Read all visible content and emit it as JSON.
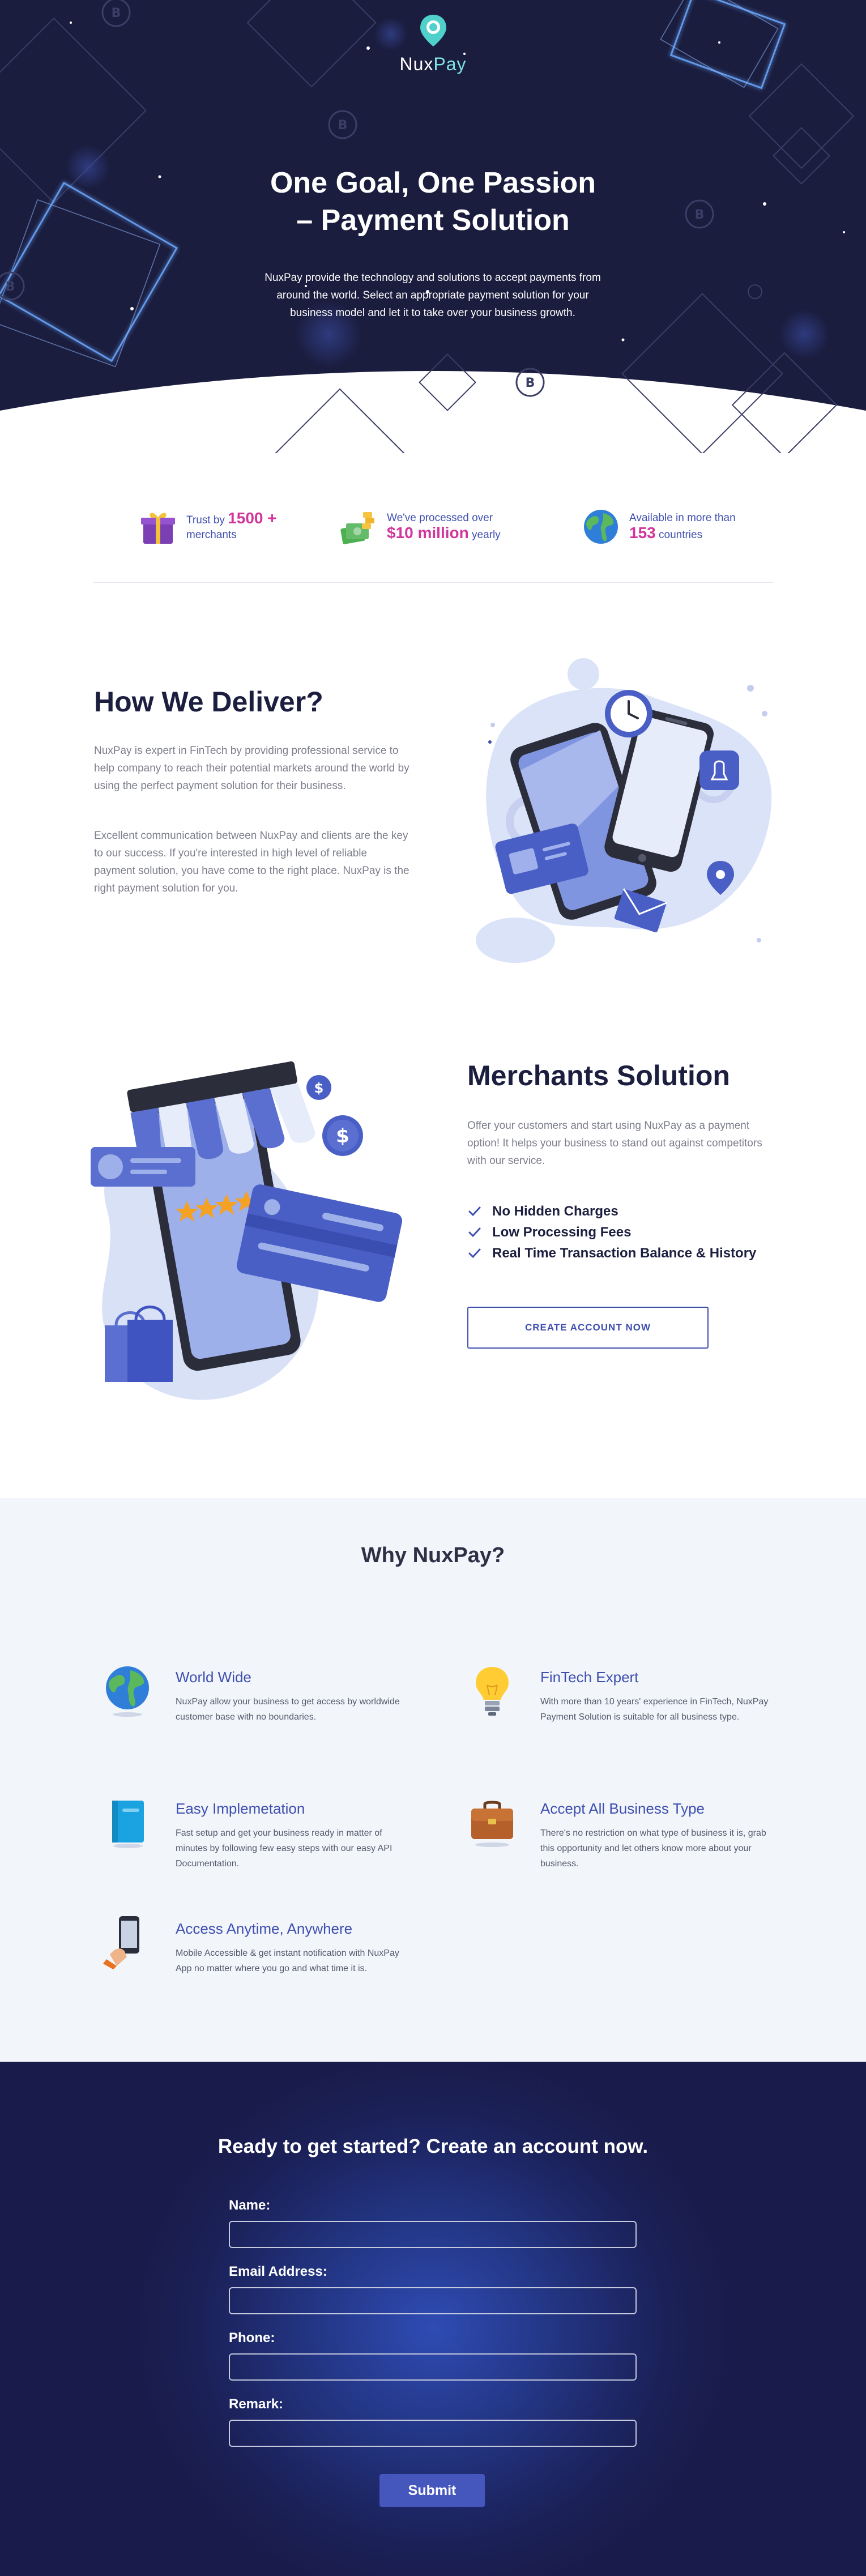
{
  "colors": {
    "hero_bg": "#1b1d3e",
    "brand_blue": "#3f4fb0",
    "accent_pink": "#d2359b",
    "accent_teal": "#7fe3df",
    "heading_dark": "#1c1e3f",
    "why_bg": "#f2f6fb",
    "submit_bg": "#4557bd"
  },
  "brand": {
    "name_prefix": "Nux",
    "name_suffix": "Pay",
    "icon": "location-pin-icon"
  },
  "hero": {
    "title_line1": "One Goal, One Passion",
    "title_line2": "– Payment Solution",
    "description": "NuxPay provide the technology and solutions to accept payments from around the world. Select an appropriate payment solution for your business model and let it to take over your business growth."
  },
  "stats": [
    {
      "icon": "gift-icon",
      "pre": "Trust by",
      "big": "1500 +",
      "post": "merchants"
    },
    {
      "icon": "money-stack-icon",
      "pre": "We've processed over",
      "big": "$10 million",
      "post": "yearly"
    },
    {
      "icon": "globe-icon",
      "pre": "Available in more than",
      "big": "153",
      "post": "countries"
    }
  ],
  "how": {
    "title": "How We Deliver?",
    "p1": "NuxPay is expert in FinTech by providing professional service to help company to reach their potential markets around the world by using the perfect payment solution for their business.",
    "p2": "Excellent communication between NuxPay and clients are the key to our success. If you're interested in high level of reliable payment solution, you have come to the right place. NuxPay is the right payment solution for you."
  },
  "merchants": {
    "title": "Merchants Solution",
    "description": "Offer your customers and start using NuxPay as a payment option! It helps your business to stand out against competitors with our service.",
    "features": [
      "No Hidden Charges",
      "Low Processing Fees",
      "Real Time Transaction Balance & History"
    ],
    "cta": "CREATE ACCOUNT NOW"
  },
  "why": {
    "title": "Why NuxPay?",
    "items": [
      {
        "icon": "globe-icon",
        "title": "World Wide",
        "desc": "NuxPay allow your business to get access by worldwide customer base with no boundaries."
      },
      {
        "icon": "lightbulb-icon",
        "title": "FinTech Expert",
        "desc": "With more than 10 years' experience in FinTech, NuxPay Payment Solution is suitable for all business type."
      },
      {
        "icon": "notebook-icon",
        "title": "Easy Implemetation",
        "desc": "Fast setup and get your business ready in matter of minutes by following few easy steps with our easy API Documentation."
      },
      {
        "icon": "briefcase-icon",
        "title": "Accept All Business Type",
        "desc": "There's no restriction on what type of business it is, grab this opportunity and let others know more about your business."
      },
      {
        "icon": "mobile-phone-icon",
        "title": "Access Anytime, Anywhere",
        "desc": "Mobile Accessible & get instant notification with NuxPay App no matter where you go and what time it is."
      }
    ]
  },
  "signup": {
    "title": "Ready to get started? Create an account now.",
    "name_label": "Name:",
    "name_value": "",
    "email_label": "Email Address:",
    "email_value": "",
    "phone_label": "Phone:",
    "phone_value": "",
    "remark_label": "Remark:",
    "remark_value": "",
    "submit": "Submit"
  }
}
